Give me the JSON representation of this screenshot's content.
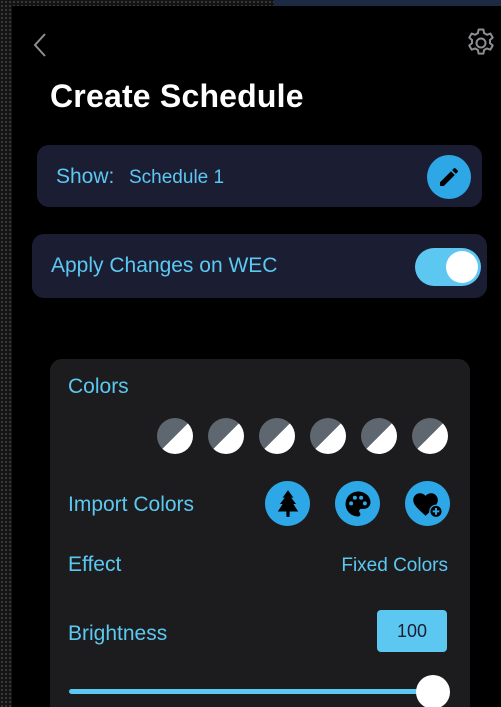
{
  "header": {
    "back_icon": "chevron-left-icon",
    "settings_icon": "gear-icon",
    "title": "Create Schedule"
  },
  "show": {
    "label": "Show:",
    "value": "Schedule 1",
    "edit_icon": "pencil-icon"
  },
  "wec": {
    "label": "Apply Changes on WEC",
    "toggle_on": true
  },
  "colors": {
    "label": "Colors",
    "swatches": [
      {
        "top": "#5e6770",
        "bottom": "#ffffff"
      },
      {
        "top": "#5e6770",
        "bottom": "#ffffff"
      },
      {
        "top": "#5e6770",
        "bottom": "#ffffff"
      },
      {
        "top": "#5e6770",
        "bottom": "#ffffff"
      },
      {
        "top": "#5e6770",
        "bottom": "#ffffff"
      },
      {
        "top": "#5e6770",
        "bottom": "#ffffff"
      }
    ]
  },
  "import_colors": {
    "label": "Import Colors",
    "icons": [
      "tree-icon",
      "palette-icon",
      "heart-plus-icon"
    ]
  },
  "effect": {
    "label": "Effect",
    "value": "Fixed Colors"
  },
  "brightness": {
    "label": "Brightness",
    "value": "100",
    "level_percent": 100
  },
  "colors_theme": {
    "accent": "#5cc8f2",
    "button_blue": "#2ea7e6",
    "card_bg": "#1b1d33",
    "panel_bg": "#1c1c1e"
  }
}
